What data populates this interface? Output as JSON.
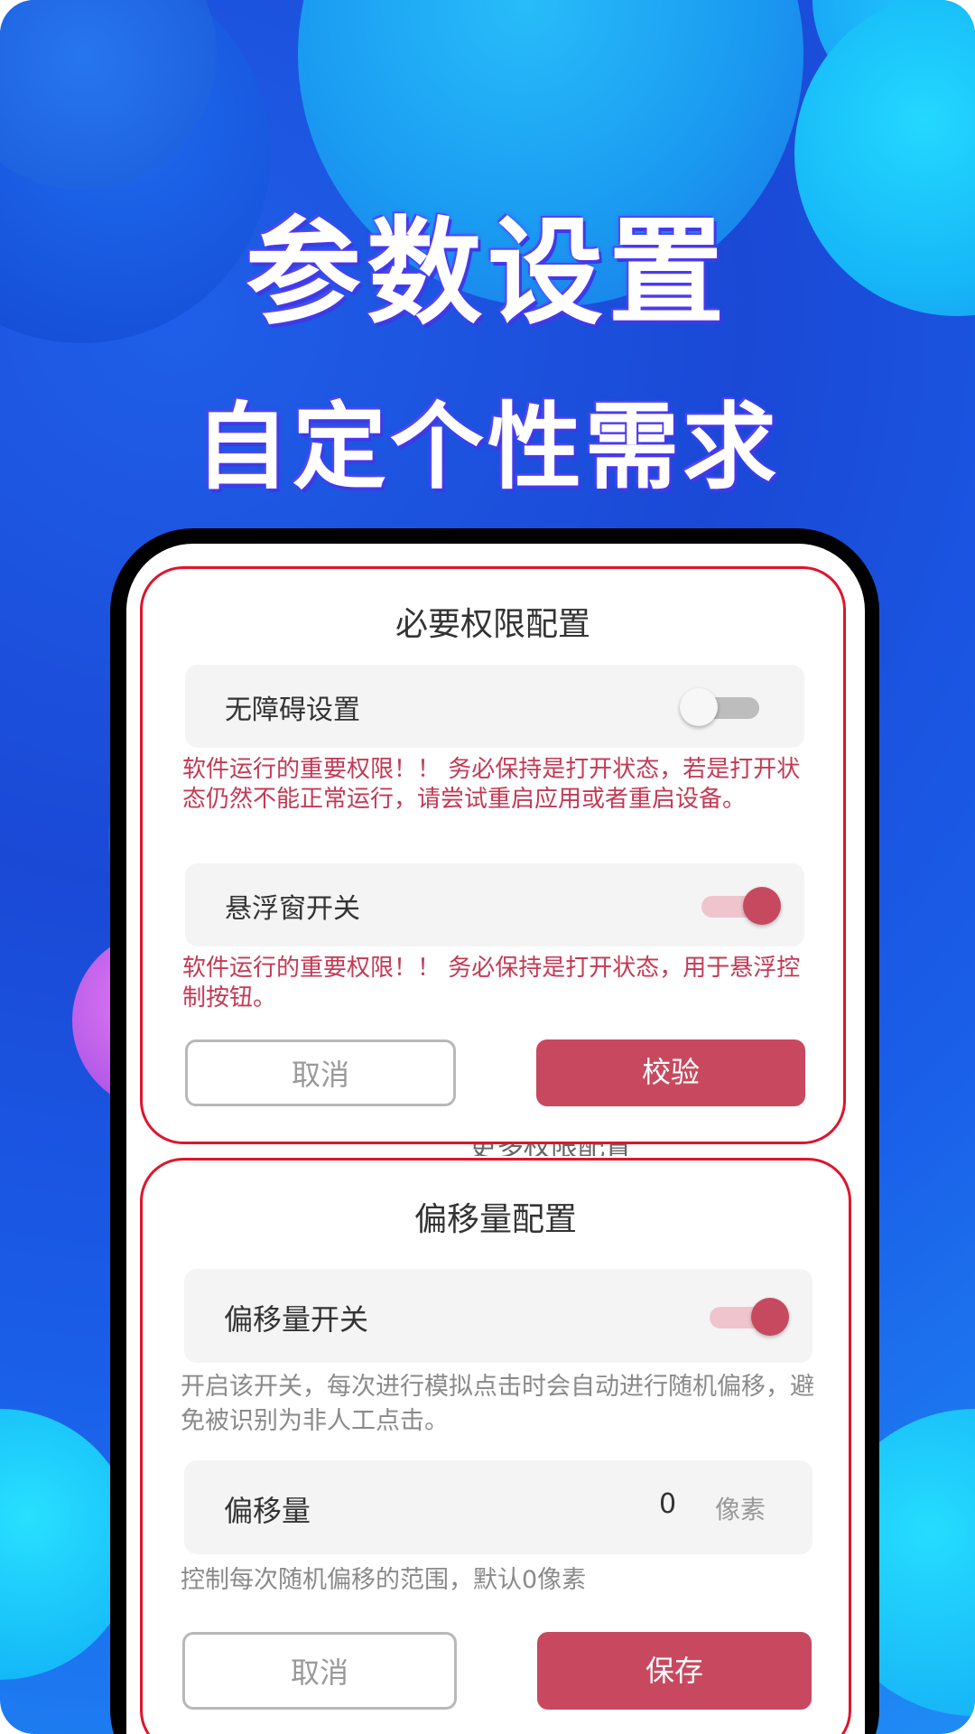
{
  "headline": {
    "line1": "参数设置",
    "line2": "自定个性需求"
  },
  "permission_card": {
    "title": "必要权限配置",
    "accessibility": {
      "label": "无障碍设置",
      "enabled": false
    },
    "accessibility_warning": "软件运行的重要权限！！ 务必保持是打开状态，若是打开状态仍然不能正常运行，请尝试重启应用或者重启设备。",
    "floating_window": {
      "label": "悬浮窗开关",
      "enabled": true
    },
    "floating_warning": "软件运行的重要权限！！ 务必保持是打开状态，用于悬浮控制按钮。",
    "cancel_label": "取消",
    "verify_label": "校验",
    "accent_color": "#c8495f"
  },
  "hidden_text": "更多权限配置",
  "offset_card": {
    "title": "偏移量配置",
    "offset_switch": {
      "label": "偏移量开关",
      "enabled": true
    },
    "offset_switch_note": "开启该开关，每次进行模拟点击时会自动进行随机偏移，避免被识别为非人工点击。",
    "offset_amount": {
      "label": "偏移量",
      "value": "0",
      "unit": "像素"
    },
    "offset_amount_note": "控制每次随机偏移的范围，默认0像素",
    "cancel_label": "取消",
    "save_label": "保存"
  }
}
